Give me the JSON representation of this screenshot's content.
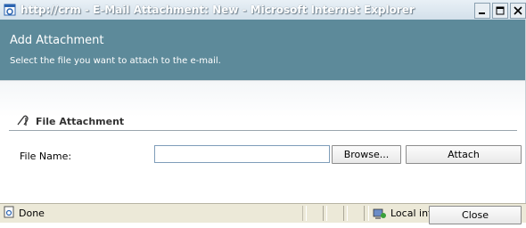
{
  "window": {
    "title": "http://crm - E-Mail Attachment: New - Microsoft Internet Explorer",
    "minimize_glyph": "_",
    "maximize_glyph": "□",
    "close_glyph": "X"
  },
  "header": {
    "title": "Add Attachment",
    "subtitle": "Select the file you want to attach to the e-mail."
  },
  "section": {
    "title": "File Attachment",
    "icon": "paperclip-icon"
  },
  "form": {
    "file_name_label": "File Name:",
    "file_name_value": "",
    "browse_label": "Browse...",
    "attach_label": "Attach",
    "close_label": "Close"
  },
  "statusbar": {
    "status_text": "Done",
    "zone_text": "Local intranet"
  },
  "colors": {
    "header_bg": "#5d8a9a",
    "status_bg": "#ece9d8"
  }
}
